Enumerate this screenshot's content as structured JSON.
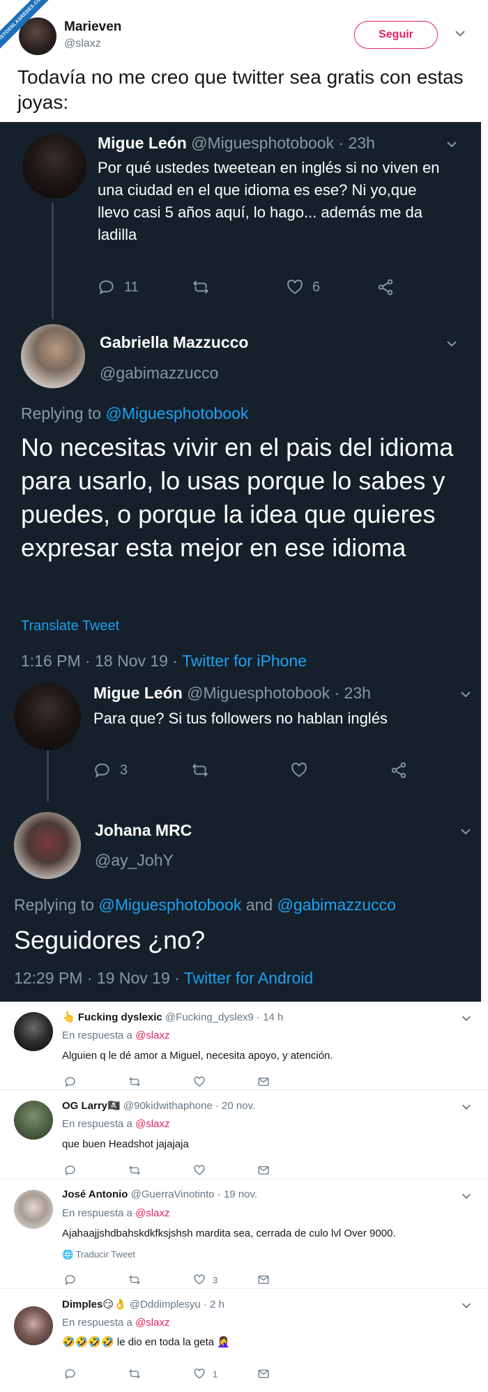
{
  "watermark": {
    "text": "VISTOENLASREDES.COM"
  },
  "top_tweet": {
    "name": "Marieven",
    "handle": "@slaxz",
    "follow_label": "Seguir",
    "text": "Todavía no me creo que twitter sea gratis con estas joyas:"
  },
  "embedded": {
    "tweet1": {
      "name": "Migue León",
      "handle": "@Miguesphotobook",
      "time": "· 23h",
      "text": "Por qué ustedes tweetean en inglés si no viven en una ciudad en el que idioma es ese? Ni yo,que llevo casi 5 años aquí, lo hago... además me da ladilla",
      "replies": "11",
      "retweets": "",
      "likes": "6"
    },
    "tweet2": {
      "name": "Gabriella Mazzucco",
      "handle": "@gabimazzucco",
      "replying_prefix": "Replying to",
      "replying_to": "@Miguesphotobook",
      "text": "No necesitas vivir en el pais del idioma para usarlo, lo usas porque lo sabes y puedes, o porque la idea que quieres expresar esta mejor en ese idioma",
      "translate": "Translate Tweet",
      "timestamp": "1:16 PM · 18 Nov 19 ·",
      "source": "Twitter for iPhone"
    },
    "tweet3": {
      "name": "Migue León",
      "handle": "@Miguesphotobook",
      "time": "· 23h",
      "text": "Para que? Si tus followers no hablan inglés",
      "replies": "3"
    },
    "tweet4": {
      "name": "Johana MRC",
      "handle": "@ay_JohY",
      "replying_prefix": "Replying to",
      "replying_to_1": "@Miguesphotobook",
      "and": "and",
      "replying_to_2": "@gabimazzucco",
      "text": "Seguidores ¿no?",
      "timestamp": "12:29 PM · 19 Nov 19 ·",
      "source": "Twitter for Android"
    }
  },
  "replies": [
    {
      "emoji": "👆",
      "name": "Fucking dyslexic",
      "handle": "@Fucking_dyslex9",
      "time": "· 14 h",
      "resp_prefix": "En respuesta a",
      "resp_to": "@slaxz",
      "text": "Alguien q le dé amor a Miguel, necesita apoyo, y atención.",
      "likes": ""
    },
    {
      "name": "OG Larry🏴‍☠️",
      "handle": "@90kidwithaphone",
      "time": "· 20 nov.",
      "resp_prefix": "En respuesta a",
      "resp_to": "@slaxz",
      "text": "que buen Headshot jajajaja",
      "likes": ""
    },
    {
      "name": "José Antonio",
      "handle": "@GuerraVinotinto",
      "time": "· 19 nov.",
      "resp_prefix": "En respuesta a",
      "resp_to": "@slaxz",
      "text": "Ajahaajjshdbahskdkfksjshsh mardita sea, cerrada de culo lvl Over 9000.",
      "translate": "Traducir Tweet",
      "likes": "3"
    },
    {
      "name": "Dimples😏👌",
      "handle": "@Dddimplesyu",
      "time": "· 2 h",
      "resp_prefix": "En respuesta a",
      "resp_to": "@slaxz",
      "text": "🤣🤣🤣🤣 le dio en toda la geta 🤦‍♀️",
      "likes": "1"
    }
  ],
  "colors": {
    "dark_bg": "#15202b",
    "dark_secondary": "#8899a6",
    "link_blue": "#1da1f2",
    "follow_pink": "#e0245e"
  }
}
